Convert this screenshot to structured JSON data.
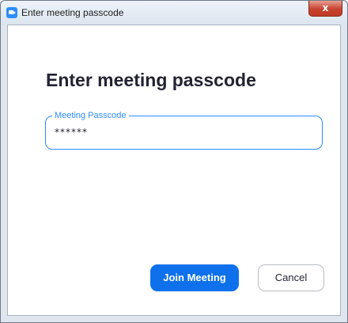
{
  "window": {
    "title": "Enter meeting passcode",
    "close_glyph": "x",
    "app_icon": "zoom-app-icon"
  },
  "main": {
    "heading": "Enter meeting passcode",
    "passcode_field": {
      "label": "Meeting Passcode",
      "value": "******"
    },
    "buttons": {
      "join_label": "Join Meeting",
      "cancel_label": "Cancel"
    }
  },
  "colors": {
    "accent": "#2d8cff",
    "primary_button": "#0e71eb",
    "close_button": "#c7432f",
    "text": "#232333"
  }
}
